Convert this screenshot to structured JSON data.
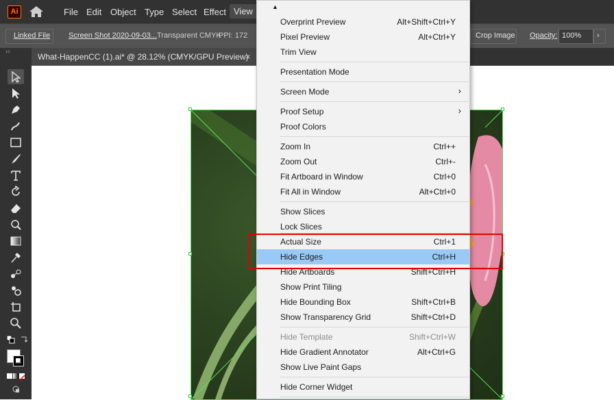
{
  "app": {
    "logo_text": "Ai"
  },
  "menubar": {
    "items": [
      "File",
      "Edit",
      "Object",
      "Type",
      "Select",
      "Effect",
      "View"
    ]
  },
  "controlbar": {
    "linked_file": "Linked File",
    "filename": "Screen Shot 2020-09-03...",
    "colorspace": "Transparent CMYK",
    "ppi": "PPI: 172",
    "crop_image": "Crop Image",
    "opacity_label": "Opacity:",
    "opacity_value": "100%"
  },
  "tab": {
    "title": "What-HappenCC (1).ai* @ 28.12% (CMYK/GPU Preview)",
    "close": "×"
  },
  "view_menu": {
    "items": [
      {
        "label": "Overprint Preview",
        "shortcut": "Alt+Shift+Ctrl+Y"
      },
      {
        "label": "Pixel Preview",
        "shortcut": "Alt+Ctrl+Y"
      },
      {
        "label": "Trim View",
        "shortcut": ""
      },
      {
        "label": "Presentation Mode",
        "shortcut": ""
      },
      {
        "label": "Screen Mode",
        "shortcut": "",
        "submenu": true
      },
      {
        "label": "Proof Setup",
        "shortcut": "",
        "submenu": true
      },
      {
        "label": "Proof Colors",
        "shortcut": ""
      },
      {
        "label": "Zoom In",
        "shortcut": "Ctrl++"
      },
      {
        "label": "Zoom Out",
        "shortcut": "Ctrl+-"
      },
      {
        "label": "Fit Artboard in Window",
        "shortcut": "Ctrl+0"
      },
      {
        "label": "Fit All in Window",
        "shortcut": "Alt+Ctrl+0"
      },
      {
        "label": "Show Slices",
        "shortcut": ""
      },
      {
        "label": "Lock Slices",
        "shortcut": ""
      },
      {
        "label": "Actual Size",
        "shortcut": "Ctrl+1"
      },
      {
        "label": "Hide Edges",
        "shortcut": "Ctrl+H",
        "hover": true
      },
      {
        "label": "Hide Artboards",
        "shortcut": "Shift+Ctrl+H"
      },
      {
        "label": "Show Print Tiling",
        "shortcut": ""
      },
      {
        "label": "Hide Bounding Box",
        "shortcut": "Shift+Ctrl+B"
      },
      {
        "label": "Show Transparency Grid",
        "shortcut": "Shift+Ctrl+D"
      },
      {
        "label": "Hide Template",
        "shortcut": "Shift+Ctrl+W",
        "disabled": true
      },
      {
        "label": "Hide Gradient Annotator",
        "shortcut": "Alt+Ctrl+G"
      },
      {
        "label": "Show Live Paint Gaps",
        "shortcut": ""
      },
      {
        "label": "Hide Corner Widget",
        "shortcut": ""
      }
    ]
  },
  "colors": {
    "highlight_border": "#e00000",
    "hover_row": "#99c9f5",
    "accent_logo": "#ff7c00"
  }
}
